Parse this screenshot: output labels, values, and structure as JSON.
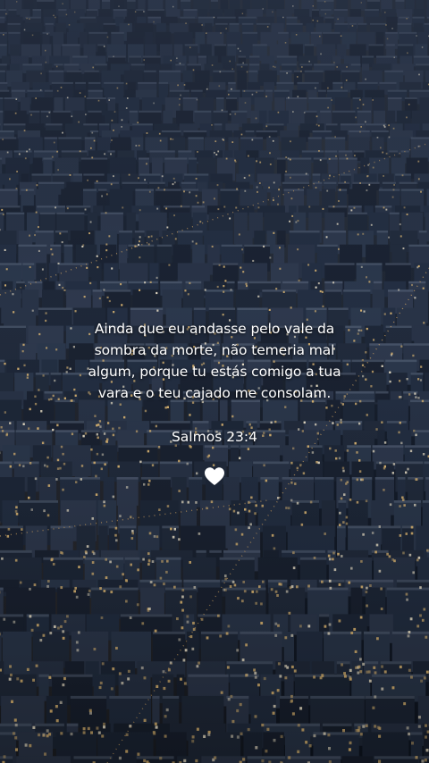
{
  "verse": {
    "line1": "Ainda que eu andasse pelo vale da",
    "line2": "sombra da morte, não temeria mal",
    "line3": "algum, porque tu estás comigo a tua",
    "line4": "vara e o teu cajado me consolam."
  },
  "reference": "Salmos 23:4",
  "icons": {
    "heart": "white-heart-icon"
  },
  "colors": {
    "text": "#ffffff",
    "sky_dusk": "#1b2434",
    "window_light": "#f2c77a"
  }
}
